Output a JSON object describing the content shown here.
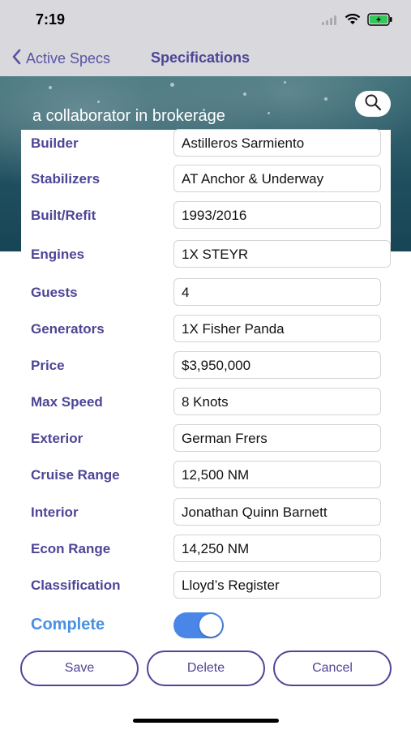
{
  "status": {
    "time": "7:19"
  },
  "nav": {
    "back_label": "Active Specs",
    "title": "Specifications"
  },
  "banner": {
    "text": "a collaborator in brokerage"
  },
  "specs": [
    {
      "label": "Builder",
      "value": "Astilleros Sarmiento"
    },
    {
      "label": "Stabilizers",
      "value": "AT Anchor & Underway"
    },
    {
      "label": "Built/Refit",
      "value": "1993/2016"
    },
    {
      "label": "Engines",
      "value": "1X STEYR"
    },
    {
      "label": "Guests",
      "value": "4"
    },
    {
      "label": "Generators",
      "value": "1X Fisher Panda"
    },
    {
      "label": "Price",
      "value": "$3,950,000"
    },
    {
      "label": "Max Speed",
      "value": "8 Knots"
    },
    {
      "label": "Exterior",
      "value": "German Frers"
    },
    {
      "label": "Cruise Range",
      "value": "12,500 NM"
    },
    {
      "label": "Interior",
      "value": "Jonathan Quinn Barnett"
    },
    {
      "label": "Econ Range",
      "value": "14,250 NM"
    },
    {
      "label": "Classification",
      "value": "Lloyd’s Register"
    }
  ],
  "complete": {
    "label": "Complete",
    "on": true
  },
  "buttons": {
    "save": "Save",
    "delete": "Delete",
    "cancel": "Cancel"
  },
  "colors": {
    "accent": "#4d4596",
    "toggle": "#4a86e8",
    "complete_label": "#4a90e2",
    "header_bg": "#d9d9dd"
  },
  "icons": {
    "back": "chevron-left-icon",
    "search": "search-icon",
    "wifi": "wifi-icon",
    "battery": "battery-icon",
    "signal": "signal-icon"
  }
}
